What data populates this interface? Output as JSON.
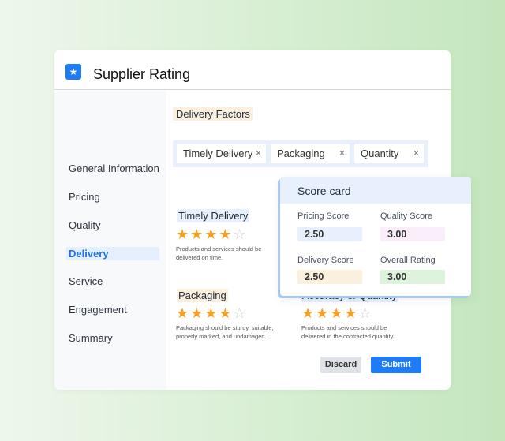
{
  "app": {
    "title": "Supplier Rating",
    "logo_icon": "user-star-icon"
  },
  "sidebar": {
    "items": [
      {
        "label": "General Information"
      },
      {
        "label": "Pricing"
      },
      {
        "label": "Quality"
      },
      {
        "label": "Delivery",
        "active": true
      },
      {
        "label": "Service"
      },
      {
        "label": "Engagement"
      },
      {
        "label": "Summary"
      }
    ]
  },
  "main": {
    "section_title": "Delivery Factors",
    "tags": [
      {
        "label": "Timely Delivery"
      },
      {
        "label": "Packaging"
      },
      {
        "label": "Quantity"
      }
    ],
    "tag_remove_symbol": "×",
    "factors": [
      {
        "title": "Timely Delivery",
        "rating": 4,
        "max": 5,
        "description_lines": [
          "Products and services should be",
          "delivered on time."
        ]
      },
      {
        "title": "Packaging",
        "rating": 4,
        "max": 5,
        "description_lines": [
          "Packaging should be sturdy, suitable,",
          "properly marked, and undamaged."
        ]
      },
      {
        "title": "Accuracy of Quantity",
        "rating": 4,
        "max": 5,
        "description_lines": [
          "Products and services should be",
          "delivered in the contracted quantity."
        ]
      }
    ],
    "discard_label": "Discard",
    "submit_label": "Submit"
  },
  "scorecard": {
    "title": "Score card",
    "pricing_label": "Pricing Score",
    "pricing_value": "2.50",
    "quality_label": "Quality Score",
    "quality_value": "3.00",
    "delivery_label": "Delivery Score",
    "delivery_value": "2.50",
    "overall_label": "Overall Rating",
    "overall_value": "3.00"
  },
  "colors": {
    "accent": "#1f7cf5",
    "star": "#f5a025"
  }
}
